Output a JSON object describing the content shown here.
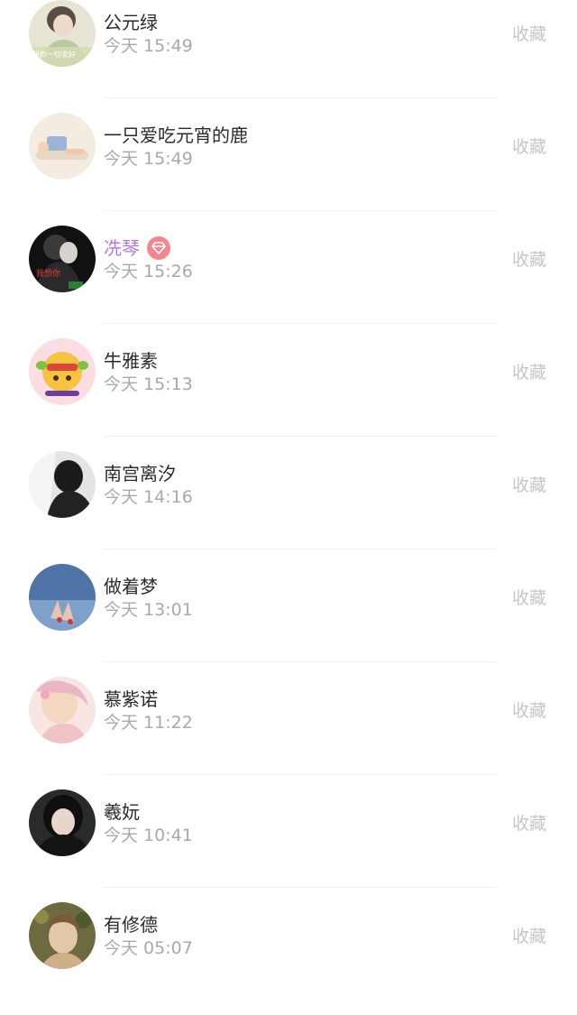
{
  "collect_label": "收藏",
  "items": [
    {
      "name": "公元绿",
      "time": "今天 15:49",
      "vip": false,
      "avatar_text": "想你一切安好"
    },
    {
      "name": "一只爱吃元宵的鹿",
      "time": "今天 15:49",
      "vip": false
    },
    {
      "name": "冼琴",
      "time": "今天 15:26",
      "vip": true,
      "badge_icon": "diamond-icon",
      "avatar_text": "我想你"
    },
    {
      "name": "牛雅素",
      "time": "今天 15:13",
      "vip": false
    },
    {
      "name": "南宫离汐",
      "time": "今天 14:16",
      "vip": false
    },
    {
      "name": "做着梦",
      "time": "今天 13:01",
      "vip": false
    },
    {
      "name": "慕紫诺",
      "time": "今天 11:22",
      "vip": false
    },
    {
      "name": "羲妧",
      "time": "今天 10:41",
      "vip": false
    },
    {
      "name": "有修德",
      "time": "今天 05:07",
      "vip": false
    }
  ],
  "colors": {
    "name": "#2b2b2b",
    "vip_name": "#b07be0",
    "time": "#a9a9a9",
    "collect": "#c6c6c6",
    "badge": "#f2878f"
  }
}
